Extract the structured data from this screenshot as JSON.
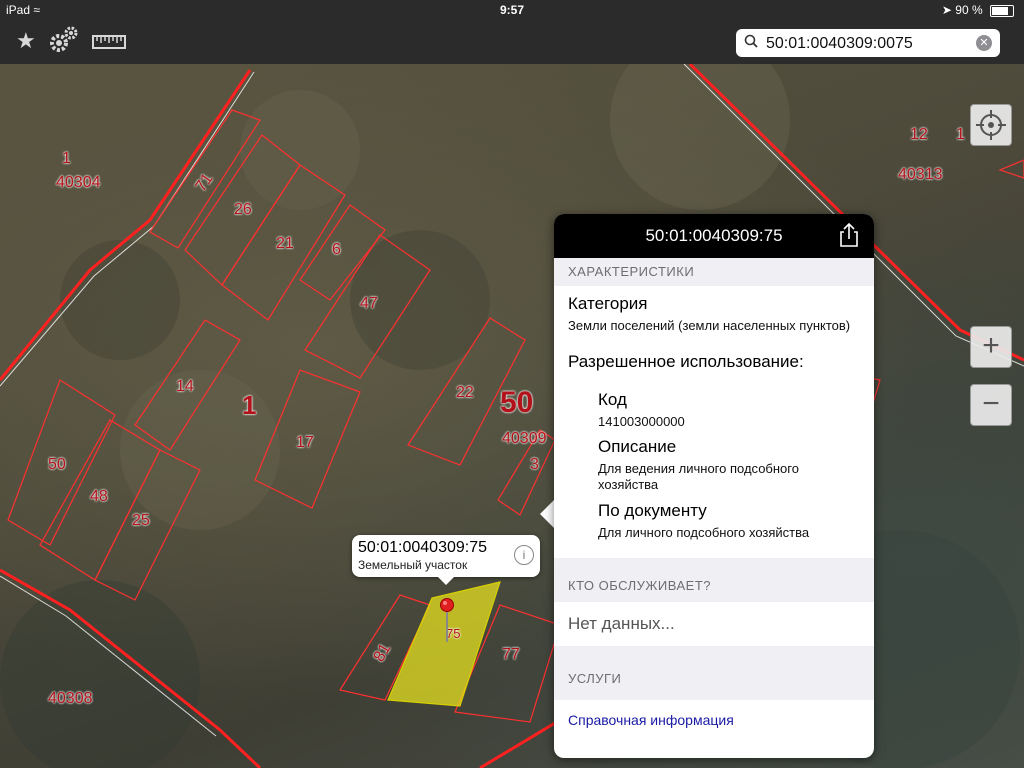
{
  "status": {
    "device": "iPad",
    "time": "9:57",
    "battery": "90 %",
    "battery_level": 0.9
  },
  "toolbar": {
    "favorites_icon": "star-icon",
    "settings_icon": "gears-icon",
    "layers_icon": "ruler-icon",
    "search_value": "50:01:0040309:0075"
  },
  "map": {
    "labels": [
      {
        "text": "1"
      },
      {
        "text": "40304"
      },
      {
        "text": "71"
      },
      {
        "text": "26"
      },
      {
        "text": "21"
      },
      {
        "text": "6"
      },
      {
        "text": "47"
      },
      {
        "text": "14"
      },
      {
        "text": "1"
      },
      {
        "text": "17"
      },
      {
        "text": "22"
      },
      {
        "text": "50"
      },
      {
        "text": "40309"
      },
      {
        "text": "3"
      },
      {
        "text": "50"
      },
      {
        "text": "48"
      },
      {
        "text": "25"
      },
      {
        "text": "81"
      },
      {
        "text": "75"
      },
      {
        "text": "77"
      },
      {
        "text": "40308"
      },
      {
        "text": "12"
      },
      {
        "text": "1"
      },
      {
        "text": "40313"
      }
    ],
    "zoom_in": "+",
    "zoom_out": "−"
  },
  "callout": {
    "title": "50:01:0040309:75",
    "subtitle": "Земельный участок"
  },
  "panel": {
    "title": "50:01:0040309:75",
    "section_characteristics": "ХАРАКТЕРИСТИКИ",
    "category_label": "Категория",
    "category_value": "Земли поселений (земли населенных пунктов)",
    "allowed_use_label": "Разрешенное использование:",
    "code_label": "Код",
    "code_value": "141003000000",
    "description_label": "Описание",
    "description_value": "Для ведения личного подсобного хозяйства",
    "by_document_label": "По документу",
    "by_document_value": "Для личного подсобного хозяйства",
    "section_service": "КТО ОБСЛУЖИВАЕТ?",
    "no_data": "Нет данных...",
    "section_services": "УСЛУГИ",
    "reference_link": "Справочная информация"
  }
}
